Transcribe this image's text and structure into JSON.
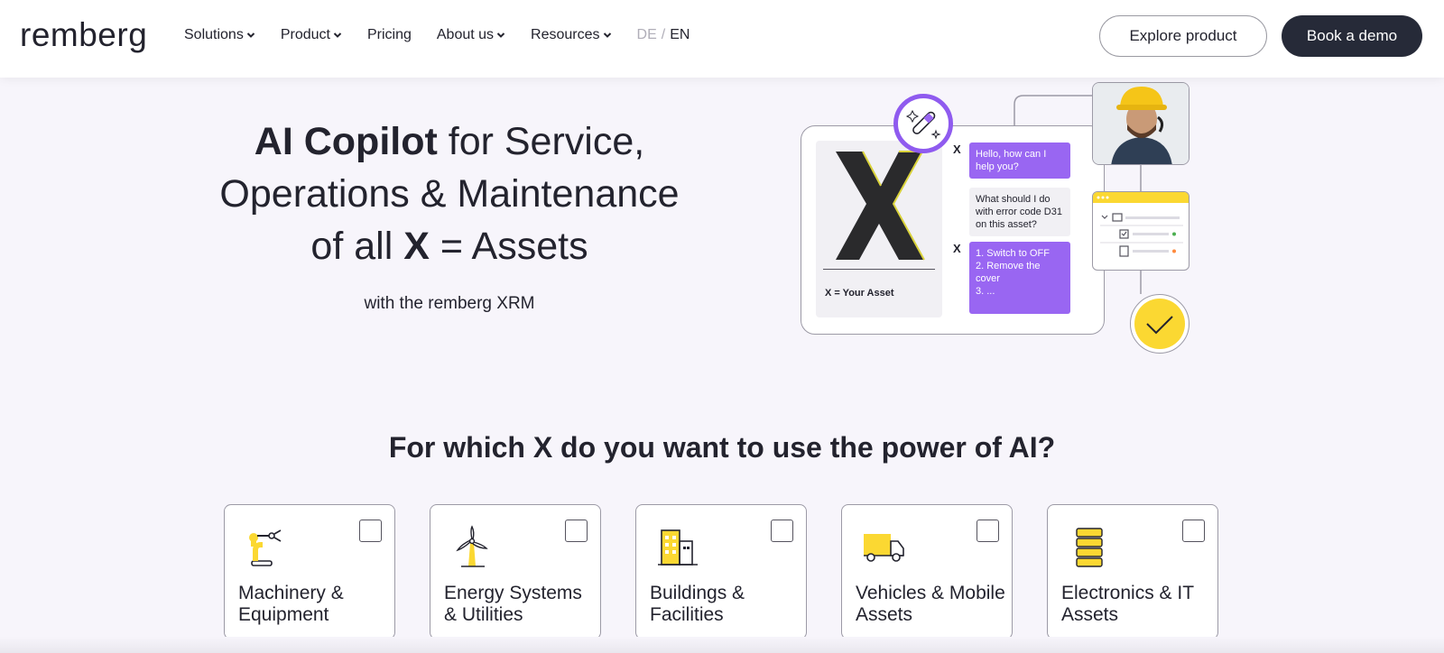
{
  "logo": "remberg",
  "nav": {
    "items": [
      {
        "label": "Solutions",
        "has_dropdown": true
      },
      {
        "label": "Product",
        "has_dropdown": true
      },
      {
        "label": "Pricing",
        "has_dropdown": false
      },
      {
        "label": "About us",
        "has_dropdown": true
      },
      {
        "label": "Resources",
        "has_dropdown": true
      }
    ],
    "lang_de": "DE",
    "lang_sep": "/",
    "lang_en": "EN",
    "explore_label": "Explore product",
    "demo_label": "Book a demo"
  },
  "hero": {
    "title_bold_1": "AI Copilot",
    "title_rest_1": " for Service,",
    "title_line_2": "Operations & Maintenance",
    "title_pre_3": "of all ",
    "title_bold_3": "X",
    "title_rest_3": " = Assets",
    "subtitle": "with the remberg XRM"
  },
  "illustration": {
    "asset_letter": "X",
    "asset_label": "X = Your Asset",
    "ai_marker": "X",
    "bubble_1": "Hello, how can I help you?",
    "bubble_2": "What should I do with error code D31 on this asset?",
    "bubble_3_lines": [
      "1. Switch to OFF",
      "2. Remove the cover",
      "3. ..."
    ]
  },
  "question": {
    "pre": "For which ",
    "bold_1": "X",
    "mid": " do you want to use the power of ",
    "bold_2": "AI",
    "post": "?"
  },
  "cards": [
    {
      "label": "Machinery & Equipment",
      "icon": "robot-arm-icon",
      "checked": false
    },
    {
      "label": "Energy Systems & Utilities",
      "icon": "wind-turbine-icon",
      "checked": false
    },
    {
      "label": "Buildings & Facilities",
      "icon": "buildings-icon",
      "checked": false
    },
    {
      "label": "Vehicles & Mobile Assets",
      "icon": "truck-icon",
      "checked": false
    },
    {
      "label": "Electronics & IT Assets",
      "icon": "server-icon",
      "checked": false
    }
  ],
  "colors": {
    "accent_purple": "#9966f2",
    "accent_yellow": "#fbd832",
    "dark": "#262a38",
    "background": "#f7f5fb"
  }
}
